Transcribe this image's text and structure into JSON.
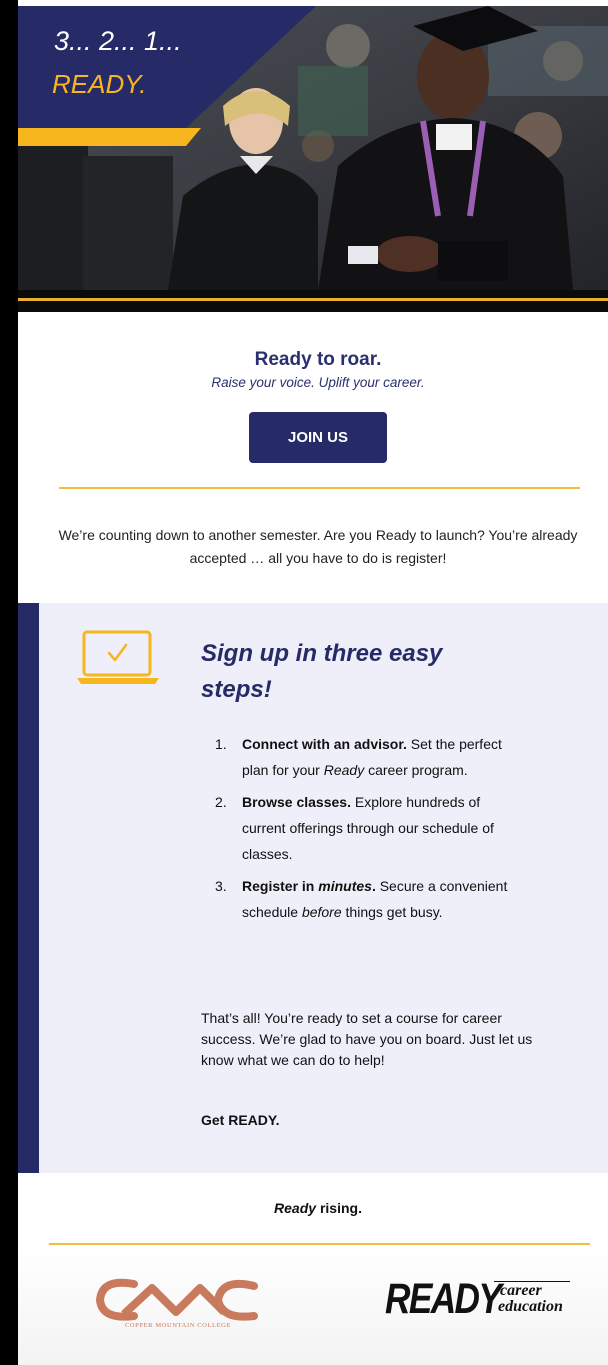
{
  "hero": {
    "countdown": "3... 2... 1...",
    "ready": "READY."
  },
  "intro": {
    "headline": "Ready to roar.",
    "subline": "Raise your voice. Uplift your career.",
    "join_label": "JOIN US",
    "body": "We’re counting down to another semester. Are you Ready to launch? You’re already accepted … all you have to do is register!"
  },
  "steps_panel": {
    "icon": "laptop-check-icon",
    "title": "Sign up in three easy steps!",
    "steps": [
      {
        "num": "1.",
        "lead": "Connect with an advisor.",
        "text_a": " Set the perfect plan for your ",
        "em": "Ready",
        "text_b": " career program."
      },
      {
        "num": "2.",
        "lead": "Browse classes.",
        "text_a": " Explore hundreds of current offerings through our schedule of classes.",
        "em": "",
        "text_b": ""
      },
      {
        "num": "3.",
        "lead_a": "Register in ",
        "lead_em": "minutes",
        "lead_b": ".",
        "text_a": " Secure a convenient schedule ",
        "em": "before",
        "text_b": " things get busy."
      }
    ],
    "closing": "That’s all! You’re ready to set a course for career success. We’re glad to have you on board. Just let us know what we can do to help!",
    "get_ready": "Get READY."
  },
  "footer": {
    "rising_em": "Ready",
    "rising_rest": " rising.",
    "college_name": "COPPER MOUNTAIN COLLEGE",
    "ready_word": "READY",
    "ready_career": "career",
    "ready_education": "education"
  },
  "colors": {
    "navy": "#262a66",
    "gold": "#f7b61d",
    "panel": "#eeeff9",
    "copper": "#c97a5c"
  }
}
